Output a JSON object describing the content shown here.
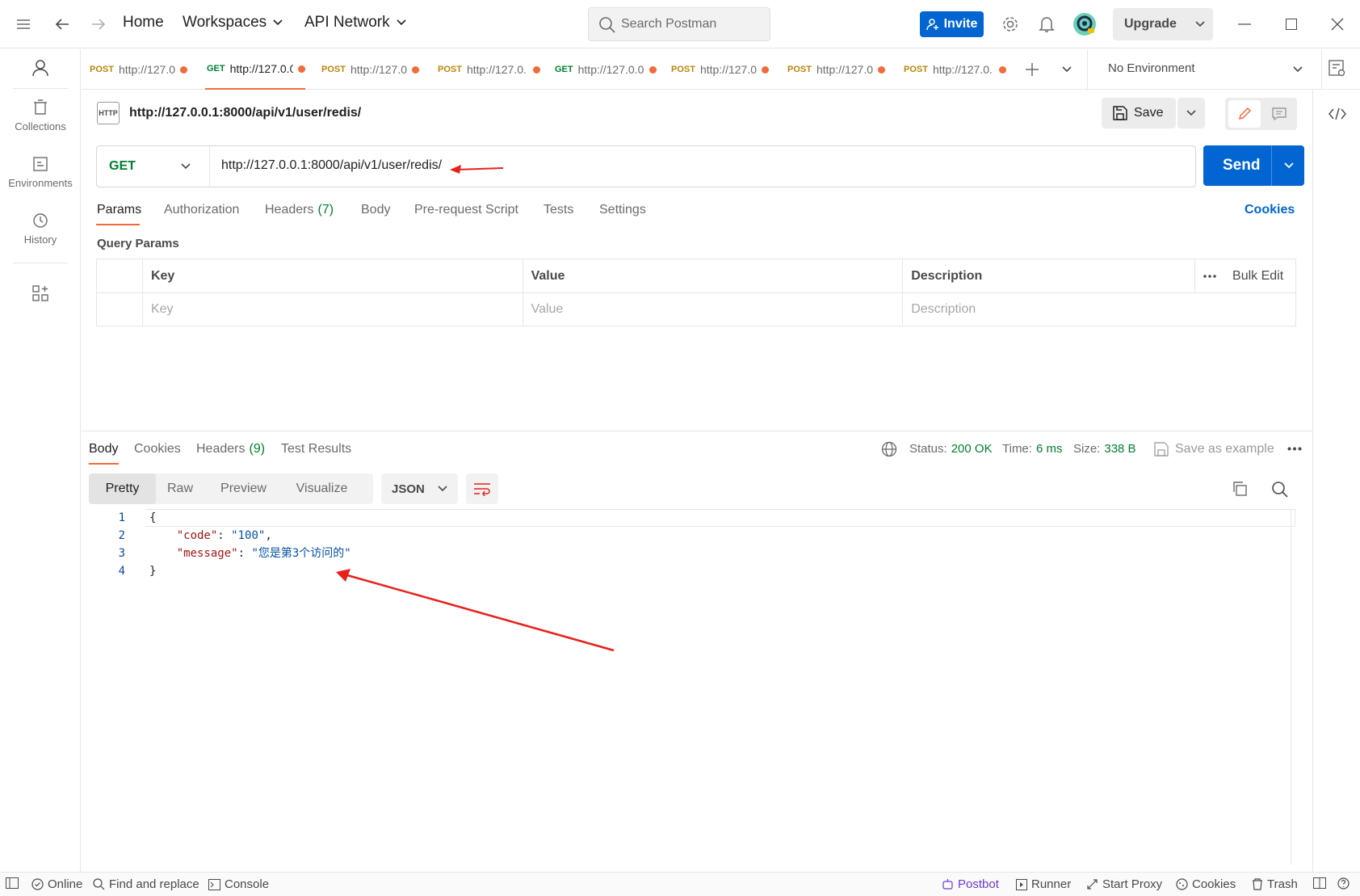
{
  "titlebar": {
    "home": "Home",
    "workspaces": "Workspaces",
    "api_network": "API Network",
    "search_placeholder": "Search Postman",
    "invite": "Invite",
    "upgrade": "Upgrade"
  },
  "sidebar": {
    "items": [
      {
        "label": "Collections",
        "icon": "collections-icon"
      },
      {
        "label": "Environments",
        "icon": "environments-icon"
      },
      {
        "label": "History",
        "icon": "history-icon"
      }
    ]
  },
  "tabs": [
    {
      "method": "POST",
      "url": "http://127.0"
    },
    {
      "method": "GET",
      "url": "http://127.0.0"
    },
    {
      "method": "POST",
      "url": "http://127.0"
    },
    {
      "method": "POST",
      "url": "http://127.0."
    },
    {
      "method": "GET",
      "url": "http://127.0.0"
    },
    {
      "method": "POST",
      "url": "http://127.0"
    },
    {
      "method": "POST",
      "url": "http://127.0"
    },
    {
      "method": "POST",
      "url": "http://127.0."
    }
  ],
  "environment": "No Environment",
  "request": {
    "badge": "HTTP",
    "title": "http://127.0.0.1:8000/api/v1/user/redis/",
    "save": "Save",
    "method": "GET",
    "url": "http://127.0.0.1:8000/api/v1/user/redis/",
    "send": "Send",
    "subtabs": {
      "params": "Params",
      "authorization": "Authorization",
      "headers": "Headers",
      "headers_count": "(7)",
      "body": "Body",
      "prerequest": "Pre-request Script",
      "tests": "Tests",
      "settings": "Settings",
      "cookies": "Cookies"
    },
    "query_params_title": "Query Params",
    "table": {
      "key": "Key",
      "value": "Value",
      "description": "Description",
      "bulk_edit": "Bulk Edit",
      "key_ph": "Key",
      "value_ph": "Value",
      "description_ph": "Description"
    }
  },
  "response": {
    "tabs": {
      "body": "Body",
      "cookies": "Cookies",
      "headers": "Headers",
      "headers_count": "(9)",
      "test_results": "Test Results"
    },
    "status_label": "Status:",
    "status_value": "200 OK",
    "time_label": "Time:",
    "time_value": "6 ms",
    "size_label": "Size:",
    "size_value": "338 B",
    "save_example": "Save as example",
    "views": [
      "Pretty",
      "Raw",
      "Preview",
      "Visualize"
    ],
    "format": "JSON",
    "code": {
      "line1_no": "1",
      "line1": "{",
      "line2_no": "2",
      "line2_key": "\"code\"",
      "line2_sep": ": ",
      "line2_val": "\"100\"",
      "line2_end": ",",
      "line3_no": "3",
      "line3_key": "\"message\"",
      "line3_sep": ": ",
      "line3_val": "\"您是第3个访问的\"",
      "line4_no": "4",
      "line4": "}"
    }
  },
  "statusbar": {
    "online": "Online",
    "find_replace": "Find and replace",
    "console": "Console",
    "postbot": "Postbot",
    "runner": "Runner",
    "start_proxy": "Start Proxy",
    "cookies": "Cookies",
    "trash": "Trash"
  },
  "colors": {
    "accent_blue": "#0265d2",
    "get_green": "#007f31",
    "post_gold": "#b8860b",
    "unsaved_orange": "#f26b3a",
    "annotation_red": "#e8201a"
  }
}
